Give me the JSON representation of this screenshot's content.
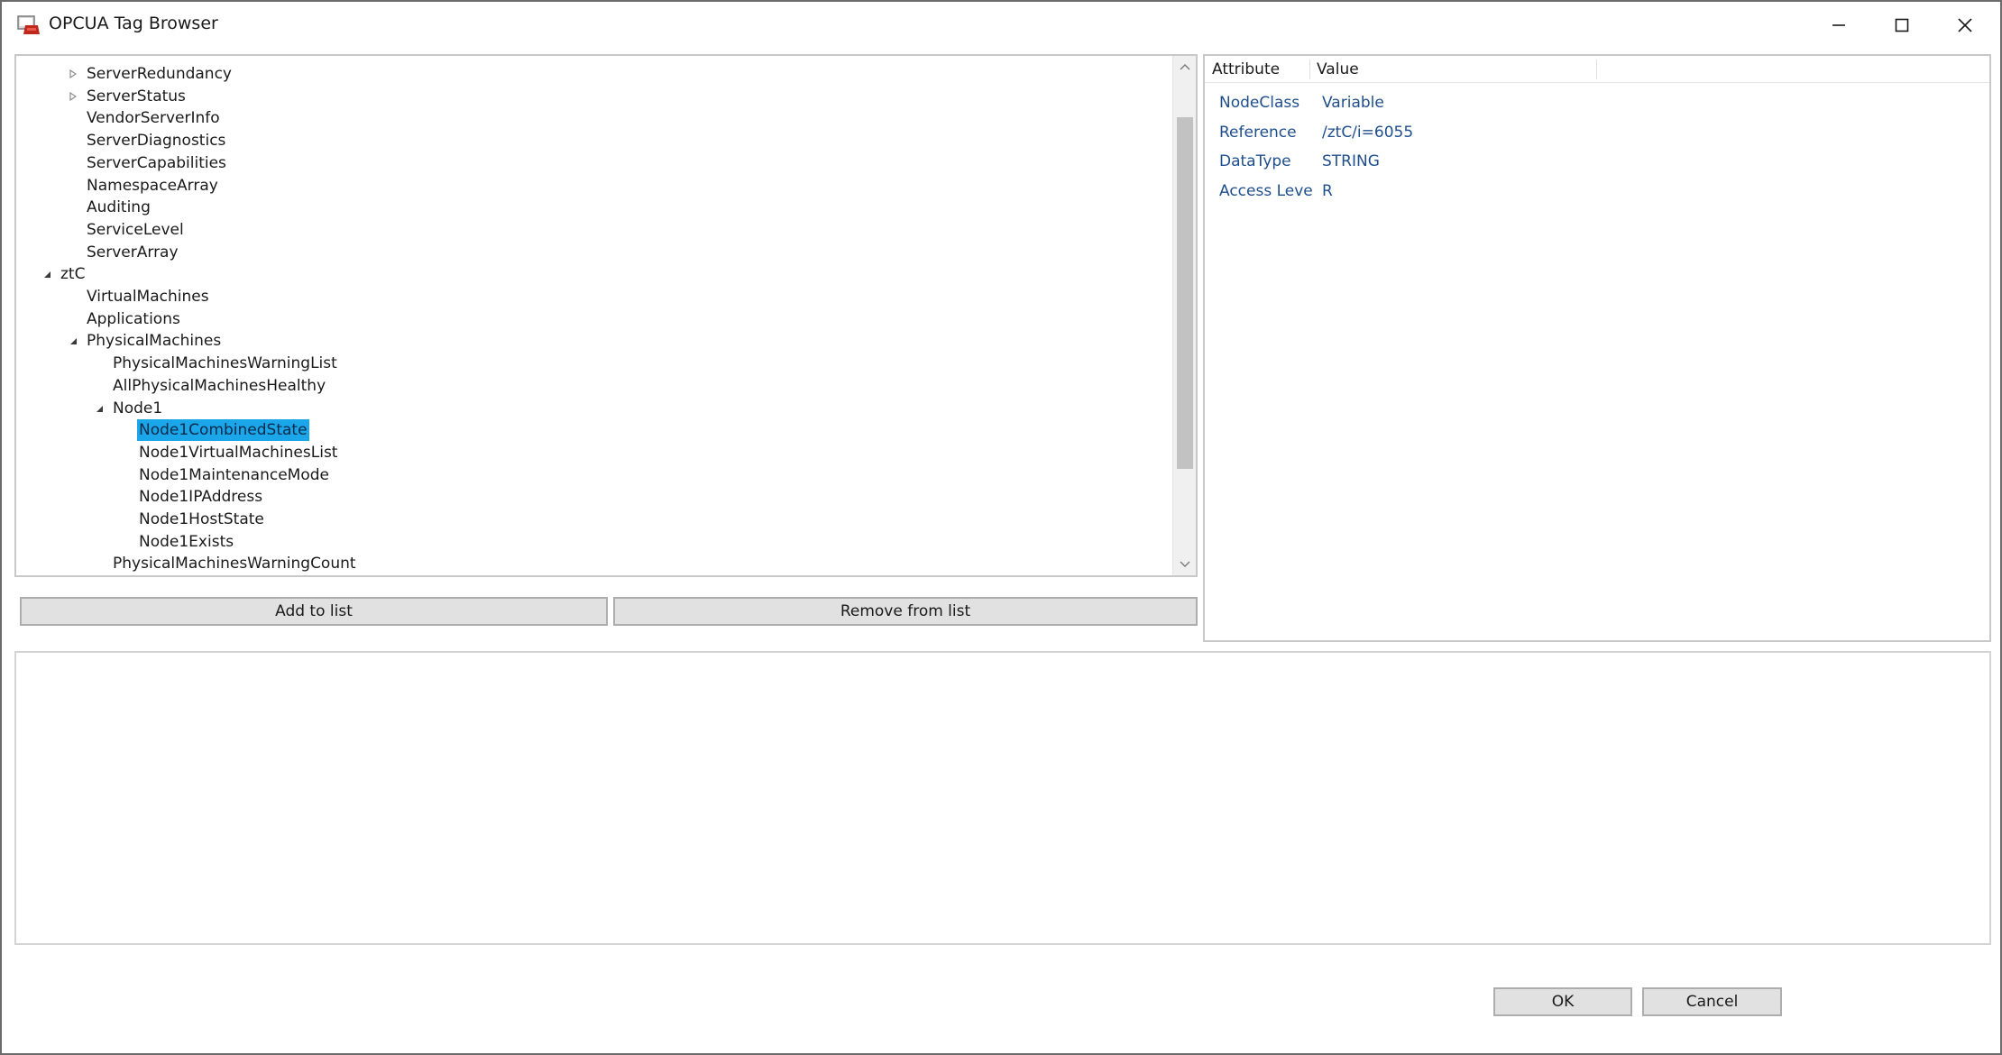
{
  "window": {
    "title": "OPCUA Tag Browser"
  },
  "icons": {
    "app": "app-icon",
    "minimize": "minimize-icon",
    "maximize": "maximize-icon",
    "close": "close-icon"
  },
  "tree": {
    "items": [
      {
        "label": "ServerRedundancy",
        "depth": 2,
        "arrow": "collapsed",
        "selected": false
      },
      {
        "label": "ServerStatus",
        "depth": 2,
        "arrow": "collapsed",
        "selected": false
      },
      {
        "label": "VendorServerInfo",
        "depth": 2,
        "arrow": "none",
        "selected": false
      },
      {
        "label": "ServerDiagnostics",
        "depth": 2,
        "arrow": "none",
        "selected": false
      },
      {
        "label": "ServerCapabilities",
        "depth": 2,
        "arrow": "none",
        "selected": false
      },
      {
        "label": "NamespaceArray",
        "depth": 2,
        "arrow": "none",
        "selected": false
      },
      {
        "label": "Auditing",
        "depth": 2,
        "arrow": "none",
        "selected": false
      },
      {
        "label": "ServiceLevel",
        "depth": 2,
        "arrow": "none",
        "selected": false
      },
      {
        "label": "ServerArray",
        "depth": 2,
        "arrow": "none",
        "selected": false
      },
      {
        "label": "ztC",
        "depth": 1,
        "arrow": "expanded",
        "selected": false
      },
      {
        "label": "VirtualMachines",
        "depth": 2,
        "arrow": "none",
        "selected": false
      },
      {
        "label": "Applications",
        "depth": 2,
        "arrow": "none",
        "selected": false
      },
      {
        "label": "PhysicalMachines",
        "depth": 2,
        "arrow": "expanded",
        "selected": false
      },
      {
        "label": "PhysicalMachinesWarningList",
        "depth": 3,
        "arrow": "none",
        "selected": false
      },
      {
        "label": "AllPhysicalMachinesHealthy",
        "depth": 3,
        "arrow": "none",
        "selected": false
      },
      {
        "label": "Node1",
        "depth": 3,
        "arrow": "expanded",
        "selected": false
      },
      {
        "label": "Node1CombinedState",
        "depth": 4,
        "arrow": "none",
        "selected": true
      },
      {
        "label": "Node1VirtualMachinesList",
        "depth": 4,
        "arrow": "none",
        "selected": false
      },
      {
        "label": "Node1MaintenanceMode",
        "depth": 4,
        "arrow": "none",
        "selected": false
      },
      {
        "label": "Node1IPAddress",
        "depth": 4,
        "arrow": "none",
        "selected": false
      },
      {
        "label": "Node1HostState",
        "depth": 4,
        "arrow": "none",
        "selected": false
      },
      {
        "label": "Node1Exists",
        "depth": 4,
        "arrow": "none",
        "selected": false
      },
      {
        "label": "PhysicalMachinesWarningCount",
        "depth": 3,
        "arrow": "none",
        "selected": false
      }
    ],
    "selection_color": "#1aa6e8"
  },
  "buttons": {
    "add_to_list": "Add to list",
    "remove_from_list": "Remove from list",
    "ok": "OK",
    "cancel": "Cancel"
  },
  "attributes": {
    "headers": [
      "Attribute",
      "Value"
    ],
    "rows": [
      {
        "attribute": "NodeClass",
        "value": "Variable"
      },
      {
        "attribute": "Reference",
        "value": "/ztC/i=6055"
      },
      {
        "attribute": "DataType",
        "value": "STRING"
      },
      {
        "attribute": "Access Leve",
        "value": "R"
      }
    ],
    "text_color": "#1f4e8c"
  },
  "selected_list": {
    "items": []
  }
}
